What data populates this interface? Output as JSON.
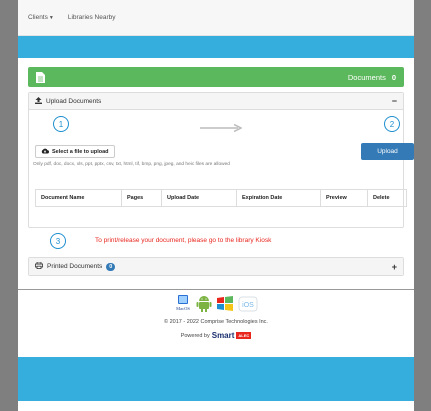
{
  "nav": {
    "clients": "Clients",
    "libraries": "Libraries Nearby"
  },
  "documents_bar": {
    "label": "Documents",
    "count": "0"
  },
  "upload_panel": {
    "title": "Upload Documents",
    "toggle": "−",
    "step1": "1",
    "step2": "2",
    "select_label": "Select a file to upload",
    "upload_label": "Upload",
    "note": "Only pdf, doc, docx, xls, ppt, pptx, csv, txt, html, tif, bmp, png, jpeg, and heic files are allowed",
    "columns": [
      "Document Name",
      "Pages",
      "Upload Date",
      "Expiration Date",
      "Preview",
      "Delete"
    ]
  },
  "print_info": {
    "step3": "3",
    "message": "To print/release your document, please go to the library Kiosk"
  },
  "printed_panel": {
    "title": "Printed Documents",
    "count": "0",
    "toggle": "+"
  },
  "footer": {
    "platforms": [
      "MacOS",
      "Android",
      "Windows",
      "iOS"
    ],
    "copyright": "© 2017 - 2022 Comprise Technologies Inc.",
    "powered_by": "Powered by",
    "brand": "Smart",
    "brand_tag": "ALEC"
  },
  "colors": {
    "band": "#35aede",
    "green": "#5cb85c",
    "blue": "#337ab7",
    "red": "#e8261e"
  }
}
